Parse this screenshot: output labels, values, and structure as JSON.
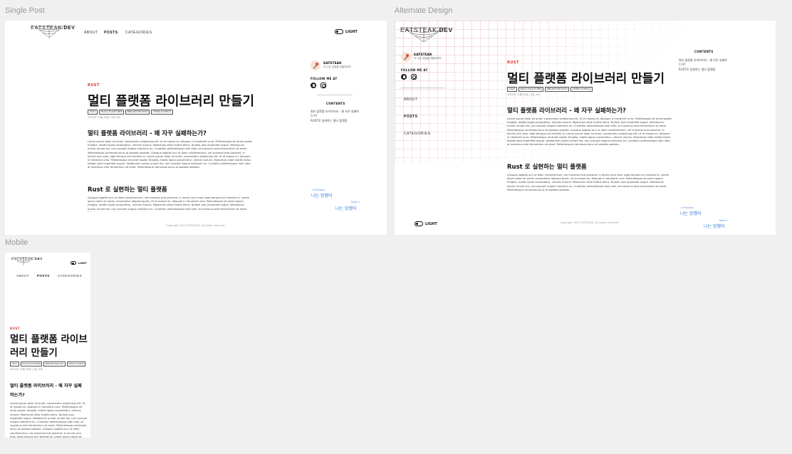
{
  "frames": {
    "single": {
      "label": "Single Post"
    },
    "alternate": {
      "label": "Alternate Design"
    },
    "mobile": {
      "label": "Mobile"
    }
  },
  "site": {
    "logo_a": "EATSTEAK",
    "logo_b": ".DEV",
    "nav": [
      "ABOUT",
      "POSTS",
      "CATEGORIES"
    ],
    "lang": "LIGHT"
  },
  "post": {
    "category": "RUST",
    "title": "멀티 플랫폼 라이브러리 만들기",
    "title_mobile_1": "멀티 플랫폼 라이브",
    "title_mobile_2": "러리 만들기",
    "tags": [
      "TEXT",
      "MULTI-PLATFORM",
      "BREAKTHROUGH",
      "OPEN-SOURCE"
    ],
    "tags_mobile": [
      "TEXT",
      "MULTI-PLATFORM",
      "BREAKTHROUGH",
      "OPEN-SOURCE"
    ],
    "date": "2022년 11월 28일 | 2분 소요",
    "h2_1": "멀티 플랫폼 라이브러리 - 왜 자꾸 실패하는가?",
    "h2_1_mobile_a": "멀티 플랫폼 라이브러리 - 왜 자꾸 실패",
    "h2_1_mobile_b": "하는가?",
    "para_1": "Lorem ipsum dolor sit amet, consectetur adipiscing elit. Ut et massa mi. Aliquam in hendrerit urna. Pellentesque sit amet sapien fringilla, mattis ligula consectetur, ultrices mauris. Maecenas vitae mattis tellus. Nullam quis imperdiet augue. Vestibulum auctor ornare leo, non suscipit magna interdum eu. Curabitur pellentesque nibh nibh, at maximus ante fermentum sit amet. Pellentesque commodo lacus at sodales sodales. Quisque sagittis orci ut diam condimentum, vel euismod erat placerat. In iaculis arcu eros, eget tempus orci facilisis id. Lorem ipsum dolor sit amet, consectetur adipiscing elit. Ut et massa mi. Aliquam in hendrerit urna. Pellentesque sit amet sapien fringilla, mattis ligula consectetur, ultrices mauris. Maecenas vitae mattis tellus. Nullam quis imperdiet augue. Vestibulum auctor ornare leo, non suscipit magna interdum eu. Curabitur pellentesque nibh nibh, at maximus ante fermentum sit amet. Pellentesque commodo lacus at sodales sodales.",
    "h2_2": "Rust 로 실현하는 멀티 플랫폼",
    "para_2": "Quisque sagittis orci ut diam condimentum, vel euismod erat placerat. In iaculis arcu eros, eget tempus orci facilisis id. Lorem ipsum dolor sit amet, consectetur adipiscing elit. Ut et massa mi. Aliquam in hendrerit urna. Pellentesque sit amet sapien fringilla, mattis ligula consectetur, ultrices mauris. Maecenas vitae mattis tellus. Nullam quis imperdiet augue. Vestibulum auctor ornare leo, non suscipit magna interdum eu. Curabitur pellentesque nibh nibh, at maximus ante fermentum sit amet. Pellentesque commodo lacus at sodales sodales."
  },
  "sidebar": {
    "author_name": "EATSTEAK",
    "author_sub": "더 나은 내일을 만들어보자",
    "follow": "FOLLOW ME AT",
    "contents_title": "CONTENTS",
    "toc": [
      "멀티 플랫폼 라이브러리 - 왜 자꾸 실패하는가?",
      "RUST로 실현하는 멀티 플랫폼"
    ],
    "prev_small": "< Previous",
    "prev_big": "나는 망했어",
    "next_small": "Next >",
    "next_big": "나는 망했어"
  },
  "footer": {
    "copyright": "Copyright 2022 EATSTEAK. All rights reserved."
  }
}
